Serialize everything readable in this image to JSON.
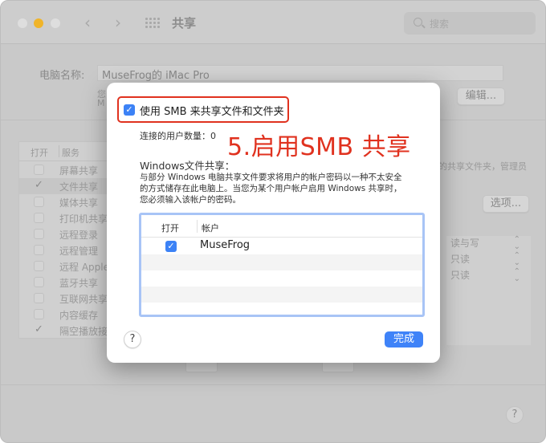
{
  "window": {
    "title": "共享",
    "search_placeholder": "搜索",
    "nav_back": "‹",
    "nav_forward": "›"
  },
  "computer_name": {
    "label": "电脑名称:",
    "value": "MuseFrog的 iMac Pro",
    "sub_line1": "您",
    "sub_line2": "M",
    "edit_button": "编辑..."
  },
  "services": {
    "header_open": "打开",
    "header_service": "服务",
    "items": [
      {
        "label": "屏幕共享",
        "checked": false,
        "selected": false
      },
      {
        "label": "文件共享",
        "checked": true,
        "selected": true
      },
      {
        "label": "媒体共享",
        "checked": false,
        "selected": false
      },
      {
        "label": "打印机共享",
        "checked": false,
        "selected": false
      },
      {
        "label": "远程登录",
        "checked": false,
        "selected": false
      },
      {
        "label": "远程管理",
        "checked": false,
        "selected": false
      },
      {
        "label": "远程 Apple",
        "checked": false,
        "selected": false
      },
      {
        "label": "蓝牙共享",
        "checked": false,
        "selected": false
      },
      {
        "label": "互联网共享",
        "checked": false,
        "selected": false
      },
      {
        "label": "内容缓存",
        "checked": false,
        "selected": false
      },
      {
        "label": "隔空播放接",
        "checked": true,
        "selected": false
      }
    ]
  },
  "right_panel": {
    "description_fragment": "的共享文件夹，管理员",
    "options_button": "选项...",
    "permissions": [
      "读与写",
      "只读",
      "只读"
    ],
    "stepper_icon": "⌃⌄"
  },
  "sheet": {
    "smb_checkbox_label": "使用 SMB 来共享文件和文件夹",
    "smb_checked": true,
    "connected_users": "连接的用户数量：0",
    "annotation": "5.启用SMB 共享",
    "windows_sharing_title": "Windows文件共享：",
    "windows_sharing_desc": "与部分 Windows 电脑共享文件要求将用户的帐户密码以一种不太安全的方式储存在此电脑上。当您为某个用户帐户启用 Windows 共享时，您必须输入该帐户的密码。",
    "table": {
      "header_open": "打开",
      "header_account": "帐户",
      "rows": [
        {
          "account": "MuseFrog",
          "checked": true
        }
      ]
    },
    "help_label": "?",
    "done_button": "完成"
  },
  "footer": {
    "help_label": "?"
  },
  "colors": {
    "accent": "#3f83f8",
    "annotation_red": "#e0321f",
    "minimize_yellow": "#f0b429"
  }
}
